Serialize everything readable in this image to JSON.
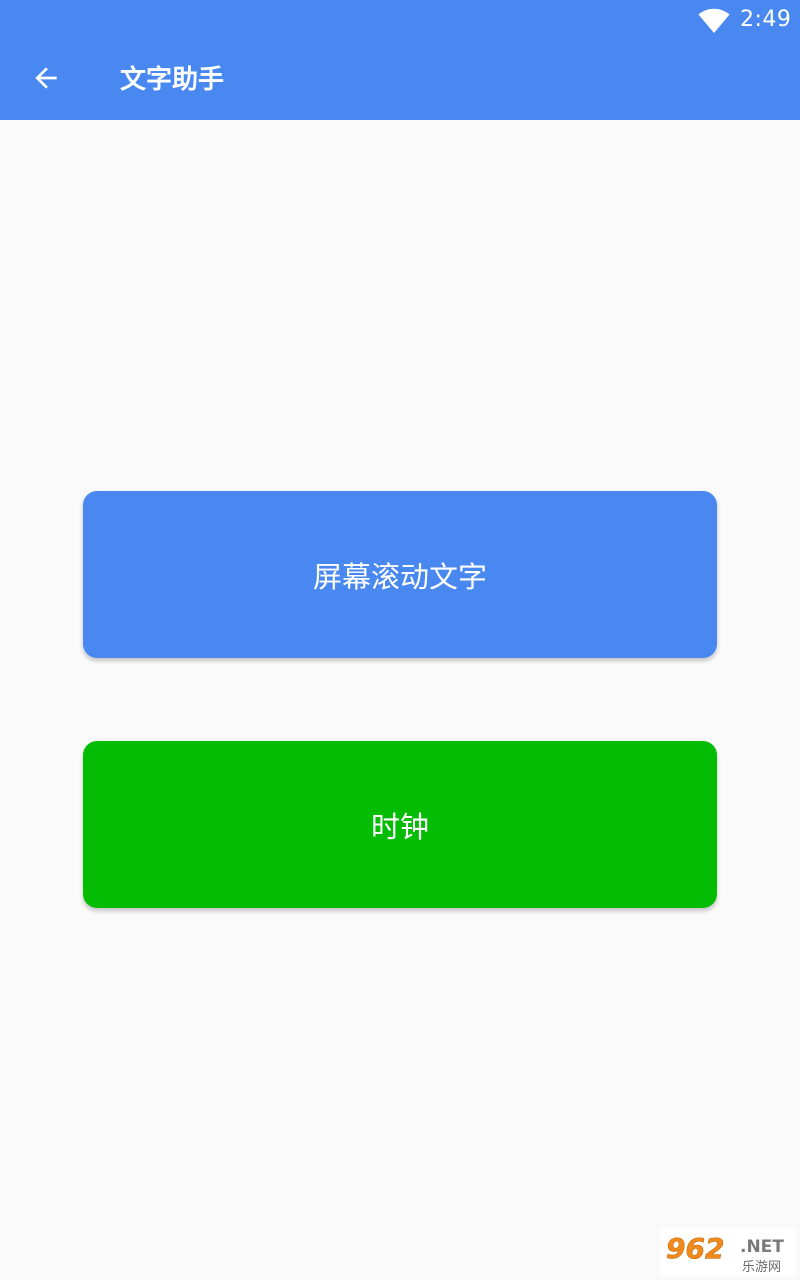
{
  "status_bar": {
    "time": "2:49",
    "wifi_icon": "wifi-icon"
  },
  "app_bar": {
    "back_icon": "arrow-back-icon",
    "title": "文字助手",
    "background": "#4888f0"
  },
  "buttons": {
    "scroll_text": {
      "label": "屏幕滚动文字",
      "color": "#4888f0"
    },
    "clock": {
      "label": "时钟",
      "color": "#05bc05"
    }
  },
  "watermark": {
    "number": "962",
    "suffix": ".NET",
    "caption": "乐游网"
  }
}
